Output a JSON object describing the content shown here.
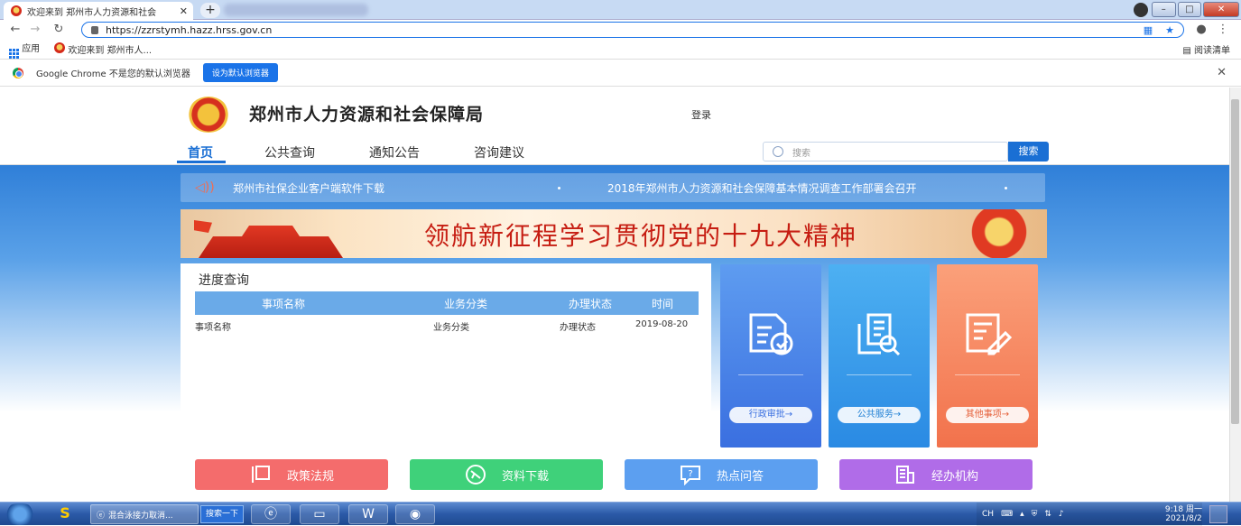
{
  "browser": {
    "tab_title": "欢迎来到 郑州市人力资源和社会",
    "tab_close": "✕",
    "new_tab": "+",
    "url": "https://zzrstymh.hazz.hrss.gov.cn",
    "bookmarks": {
      "apps": "应用",
      "item1": "欢迎来到 郑州市人...",
      "reading_list": "阅读清单"
    },
    "infobar": {
      "message": "Google Chrome 不是您的默认浏览器",
      "button": "设为默认浏览器",
      "close": "✕"
    }
  },
  "site": {
    "name": "郑州市人力资源和社会保障局",
    "login": "登录",
    "nav": {
      "home": "首页",
      "public_query": "公共查询",
      "notices": "通知公告",
      "consult": "咨询建议"
    },
    "search": {
      "placeholder": "搜索",
      "button": "搜索"
    },
    "notices": {
      "item1": "郑州市社保企业客户端软件下载",
      "item2": "2018年郑州市人力资源和社会保障基本情况调查工作部署会召开"
    },
    "banner_title": "领航新征程学习贯彻党的十九大精神",
    "progress": {
      "title": "进度查询",
      "headers": {
        "name": "事项名称",
        "category": "业务分类",
        "status": "办理状态",
        "time": "时间"
      },
      "rows": [
        {
          "name": "事项名称",
          "category": "业务分类",
          "status": "办理状态",
          "time": "2019-08-20"
        }
      ]
    },
    "cards": {
      "admin": "行政审批→",
      "public": "公共服务→",
      "other": "其他事项→"
    },
    "quick_links": {
      "policy": "政策法规",
      "download": "资料下载",
      "faq": "热点问答",
      "agencies": "经办机构"
    }
  },
  "taskbar": {
    "ie_task": "混合泳接力取消...",
    "search": "搜索一下",
    "ime": "CH",
    "time": "9:18 周一",
    "date": "2021/8/2"
  }
}
